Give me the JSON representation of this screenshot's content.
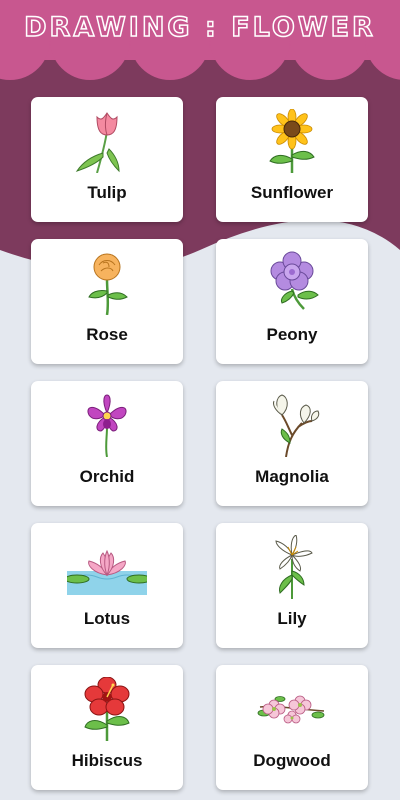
{
  "header": {
    "title": "DRAWING : FLOWER"
  },
  "colors": {
    "header_pink": "#c8578f",
    "band_maroon": "#7d3a5d",
    "background": "#e4e8ef",
    "card": "#ffffff"
  },
  "flowers": [
    {
      "label": "Tulip",
      "icon": "tulip-icon"
    },
    {
      "label": "Sunflower",
      "icon": "sunflower-icon"
    },
    {
      "label": "Rose",
      "icon": "rose-icon"
    },
    {
      "label": "Peony",
      "icon": "peony-icon"
    },
    {
      "label": "Orchid",
      "icon": "orchid-icon"
    },
    {
      "label": "Magnolia",
      "icon": "magnolia-icon"
    },
    {
      "label": "Lotus",
      "icon": "lotus-icon"
    },
    {
      "label": "Lily",
      "icon": "lily-icon"
    },
    {
      "label": "Hibiscus",
      "icon": "hibiscus-icon"
    },
    {
      "label": "Dogwood",
      "icon": "dogwood-icon"
    }
  ]
}
